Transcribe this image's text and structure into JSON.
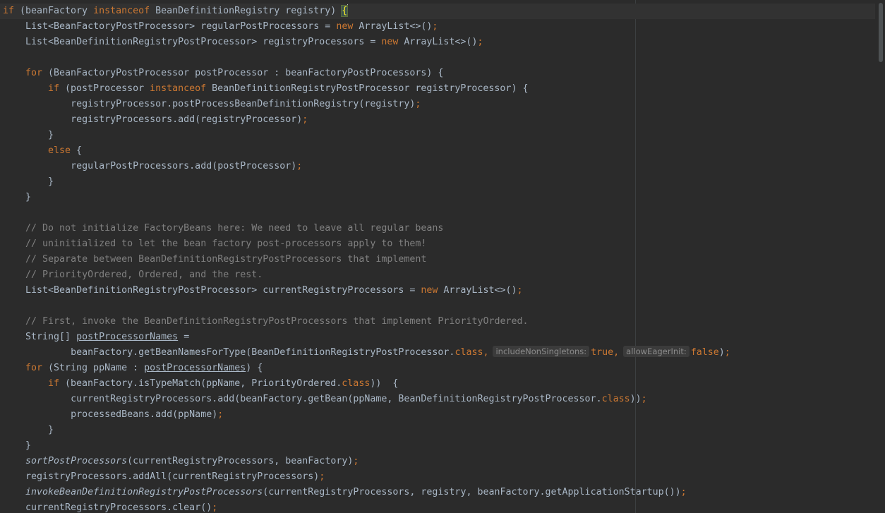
{
  "editor": {
    "lines": [
      [
        [
          "kw",
          "if"
        ],
        [
          "",
          "(beanFactory "
        ],
        [
          "kw",
          "instanceof"
        ],
        [
          "",
          "BeanDefinitionRegistry registry) "
        ],
        [
          "hl",
          "{"
        ]
      ],
      [
        [
          "",
          "    List<BeanFactoryPostProcessor> regularPostProcessors = "
        ],
        [
          "kw",
          "new"
        ],
        [
          "",
          "ArrayList<>()"
        ],
        [
          "kw",
          ";"
        ]
      ],
      [
        [
          "",
          "    List<BeanDefinitionRegistryPostProcessor> registryProcessors = "
        ],
        [
          "kw",
          "new"
        ],
        [
          "",
          "ArrayList<>()"
        ],
        [
          "kw",
          ";"
        ]
      ],
      [],
      [
        [
          "kw",
          "    for"
        ],
        [
          "",
          "(BeanFactoryPostProcessor postProcessor : beanFactoryPostProcessors) {"
        ]
      ],
      [
        [
          "kw",
          "        if"
        ],
        [
          "",
          "(postProcessor "
        ],
        [
          "kw",
          "instanceof"
        ],
        [
          "",
          "BeanDefinitionRegistryPostProcessor registryProcessor) {"
        ]
      ],
      [
        [
          "",
          "            registryProcessor.postProcessBeanDefinitionRegistry(registry)"
        ],
        [
          "kw",
          ";"
        ]
      ],
      [
        [
          "",
          "            registryProcessors.add(registryProcessor)"
        ],
        [
          "kw",
          ";"
        ]
      ],
      [
        [
          "",
          "        }"
        ]
      ],
      [
        [
          "kw",
          "        else"
        ],
        [
          "",
          "{"
        ]
      ],
      [
        [
          "",
          "            regularPostProcessors.add(postProcessor)"
        ],
        [
          "kw",
          ";"
        ]
      ],
      [
        [
          "",
          "        }"
        ]
      ],
      [
        [
          "",
          "    }"
        ]
      ],
      [],
      [
        [
          "cm",
          "    // Do not initialize FactoryBeans here: We need to leave all regular beans"
        ]
      ],
      [
        [
          "cm",
          "    // uninitialized to let the bean factory post-processors apply to them!"
        ]
      ],
      [
        [
          "cm",
          "    // Separate between BeanDefinitionRegistryPostProcessors that implement"
        ]
      ],
      [
        [
          "cm",
          "    // PriorityOrdered, Ordered, and the rest."
        ]
      ],
      [
        [
          "",
          "    List<BeanDefinitionRegistryPostProcessor> currentRegistryProcessors = "
        ],
        [
          "kw",
          "new"
        ],
        [
          "",
          "ArrayList<>()"
        ],
        [
          "kw",
          ";"
        ]
      ],
      [],
      [
        [
          "cm",
          "    // First, invoke the BeanDefinitionRegistryPostProcessors that implement PriorityOrdered."
        ]
      ],
      [
        [
          "",
          "    String[] "
        ],
        [
          "ul",
          "postProcessorNames"
        ],
        [
          "",
          " ="
        ]
      ],
      [
        [
          "",
          "            beanFactory.getBeanNamesForType(BeanDefinitionRegistryPostProcessor."
        ],
        [
          "kw",
          "class,"
        ],
        [
          "hint",
          "includeNonSingletons:"
        ],
        [
          "kw",
          "true,"
        ],
        [
          "hint",
          "allowEagerInit:"
        ],
        [
          "kw",
          "false"
        ],
        [
          "",
          ")"
        ],
        [
          "kw",
          ";"
        ]
      ],
      [
        [
          "kw",
          "    for"
        ],
        [
          "",
          "(String ppName : "
        ],
        [
          "ul",
          "postProcessorNames"
        ],
        [
          "",
          ") {"
        ]
      ],
      [
        [
          "kw",
          "        if"
        ],
        [
          "",
          "(beanFactory.isTypeMatch(ppName, PriorityOrdered."
        ],
        [
          "kw",
          "class"
        ],
        [
          "",
          "))  {"
        ]
      ],
      [
        [
          "",
          "            currentRegistryProcessors.add(beanFactory.getBean(ppName, BeanDefinitionRegistryPostProcessor."
        ],
        [
          "kw",
          "class"
        ],
        [
          "",
          "))"
        ],
        [
          "kw",
          ";"
        ]
      ],
      [
        [
          "",
          "            processedBeans.add(ppName)"
        ],
        [
          "kw",
          ";"
        ]
      ],
      [
        [
          "",
          "        }"
        ]
      ],
      [
        [
          "",
          "    }"
        ]
      ],
      [
        [
          "st",
          "    sortPostProcessors"
        ],
        [
          "",
          "(currentRegistryProcessors, beanFactory)"
        ],
        [
          "kw",
          ";"
        ]
      ],
      [
        [
          "",
          "    registryProcessors.addAll(currentRegistryProcessors)"
        ],
        [
          "kw",
          ";"
        ]
      ],
      [
        [
          "st",
          "    invokeBeanDefinitionRegistryPostProcessors"
        ],
        [
          "",
          "(currentRegistryProcessors, registry, beanFactory.getApplicationStartup())"
        ],
        [
          "kw",
          ";"
        ]
      ],
      [
        [
          "",
          "    currentRegistryProcessors.clear()"
        ],
        [
          "kw",
          ";"
        ]
      ]
    ]
  },
  "colors": {
    "background": "#2b2b2b",
    "text": "#a9b7c6",
    "keyword": "#cc7832",
    "comment": "#808080"
  }
}
